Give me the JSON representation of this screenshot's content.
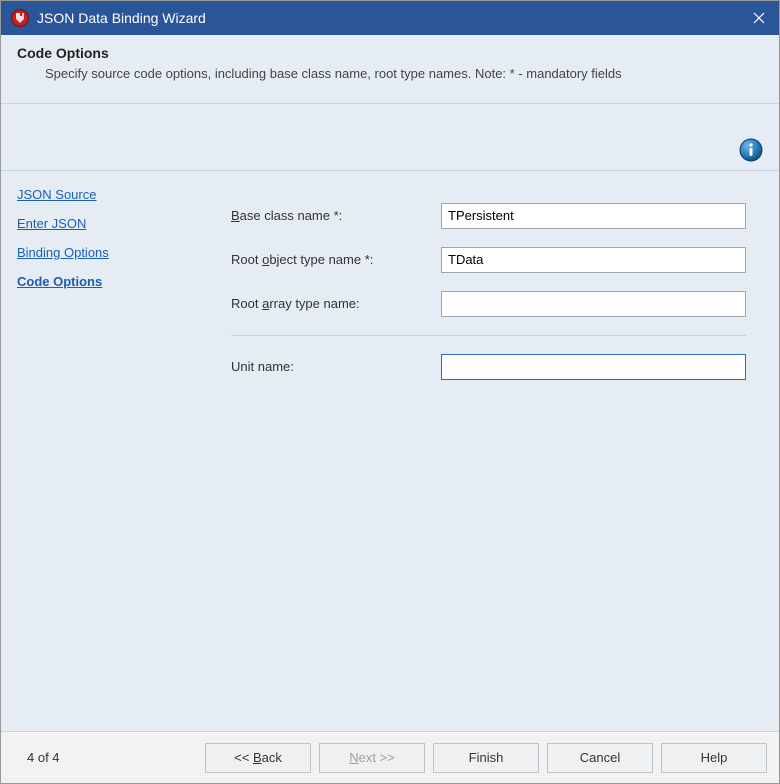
{
  "titlebar": {
    "title": "JSON Data Binding Wizard"
  },
  "header": {
    "title": "Code Options",
    "description": "Specify source code options, including base class name, root type names. Note: * - mandatory fields"
  },
  "nav": {
    "items": [
      {
        "label": "JSON Source",
        "active": false
      },
      {
        "label": "Enter JSON",
        "active": false
      },
      {
        "label": "Binding Options",
        "active": false
      },
      {
        "label": "Code Options",
        "active": true
      }
    ]
  },
  "form": {
    "base_class": {
      "label_pre": "",
      "label_u": "B",
      "label_post": "ase class name *:",
      "value": "TPersistent"
    },
    "root_object": {
      "label_pre": "Root ",
      "label_u": "o",
      "label_post": "bject type name *:",
      "value": "TData"
    },
    "root_array": {
      "label_pre": "Root ",
      "label_u": "a",
      "label_post": "rray type name:",
      "value": ""
    },
    "unit_name": {
      "label_pre": "Unit name:",
      "value": ""
    }
  },
  "footer": {
    "page_info": "4 of 4",
    "back": {
      "pre": "<< ",
      "u": "B",
      "post": "ack"
    },
    "next": {
      "pre": "",
      "u": "N",
      "post": "ext >>"
    },
    "finish": "Finish",
    "cancel": "Cancel",
    "help": "Help"
  }
}
